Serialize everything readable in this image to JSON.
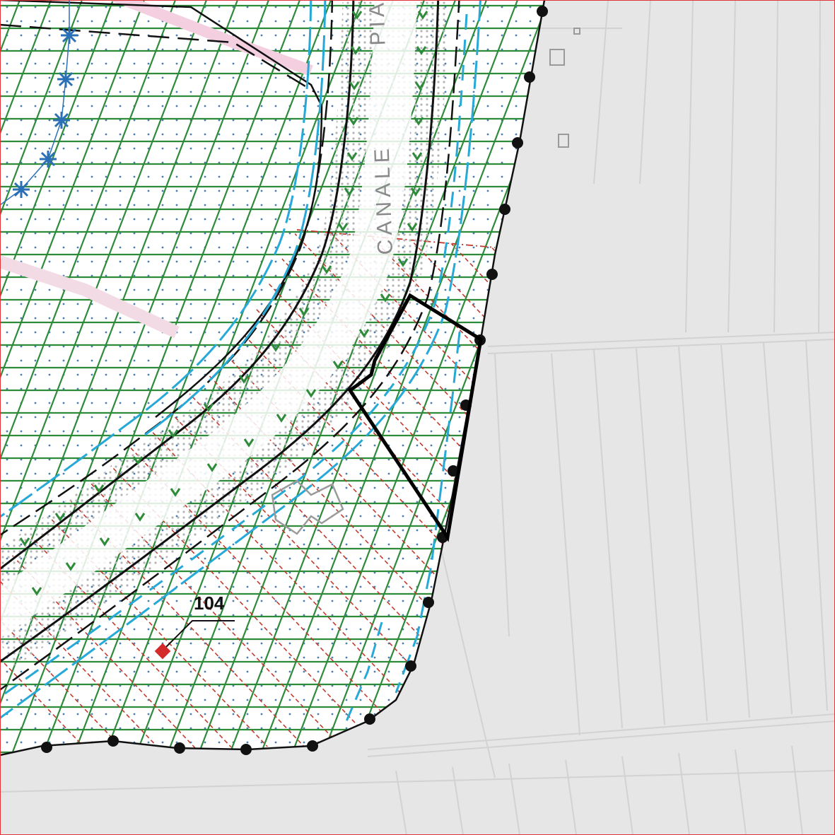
{
  "map": {
    "canal_label_1": "CANALE",
    "canal_label_2": "PIAVO",
    "parcel_label": "104"
  },
  "colors": {
    "hatch_green": "#2e8b3a",
    "hatch_red": "#c0392b",
    "canal_blue": "#27a9d8",
    "boundary_black": "#111111",
    "background_grey": "#e6e6e6",
    "frame_red": "#e0333a",
    "well_blue": "#2b6fb5"
  },
  "icons": [
    "well-star-icon",
    "red-point-icon",
    "boundary-marker-icon"
  ]
}
